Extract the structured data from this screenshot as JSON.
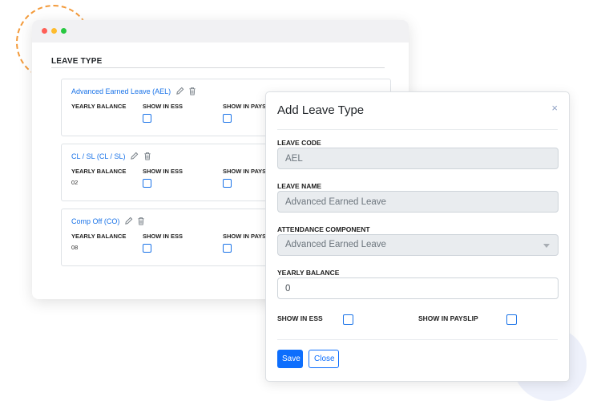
{
  "background": {
    "accent_orange": "#f39a3a",
    "accent_circle": "#eef1fb"
  },
  "window": {
    "dots": [
      "red",
      "yellow",
      "green"
    ],
    "section_title": "LEAVE TYPE",
    "cards": [
      {
        "title": "Advanced Earned Leave (AEL)",
        "col1": "YEARLY BALANCE",
        "col2": "SHOW IN ESS",
        "col3": "SHOW IN PAYS",
        "balance": ""
      },
      {
        "title": "CL / SL (CL / SL)",
        "col1": "YEARLY BALANCE",
        "col2": "SHOW IN ESS",
        "col3": "SHOW IN PAYS",
        "balance": "02"
      },
      {
        "title": "Comp Off (CO)",
        "col1": "YEARLY BALANCE",
        "col2": "SHOW IN ESS",
        "col3": "SHOW IN PAYS",
        "balance": "08"
      }
    ]
  },
  "modal": {
    "title": "Add Leave Type",
    "close_glyph": "×",
    "leave_code": {
      "label": "LEAVE CODE",
      "value": "AEL"
    },
    "leave_name": {
      "label": "LEAVE NAME",
      "value": "Advanced Earned Leave"
    },
    "attendance_component": {
      "label": "ATTENDANCE COMPONENT",
      "value": "Advanced Earned Leave"
    },
    "yearly_balance": {
      "label": "YEARLY BALANCE",
      "value": "0"
    },
    "show_in_ess": {
      "label": "SHOW IN ESS",
      "checked": false
    },
    "show_in_payslip": {
      "label": "SHOW IN PAYSLIP",
      "checked": false
    },
    "save_label": "Save",
    "close_label": "Close"
  },
  "colors": {
    "primary": "#0d6efd",
    "link": "#1a73e8",
    "disabled_bg": "#e9ecef"
  }
}
